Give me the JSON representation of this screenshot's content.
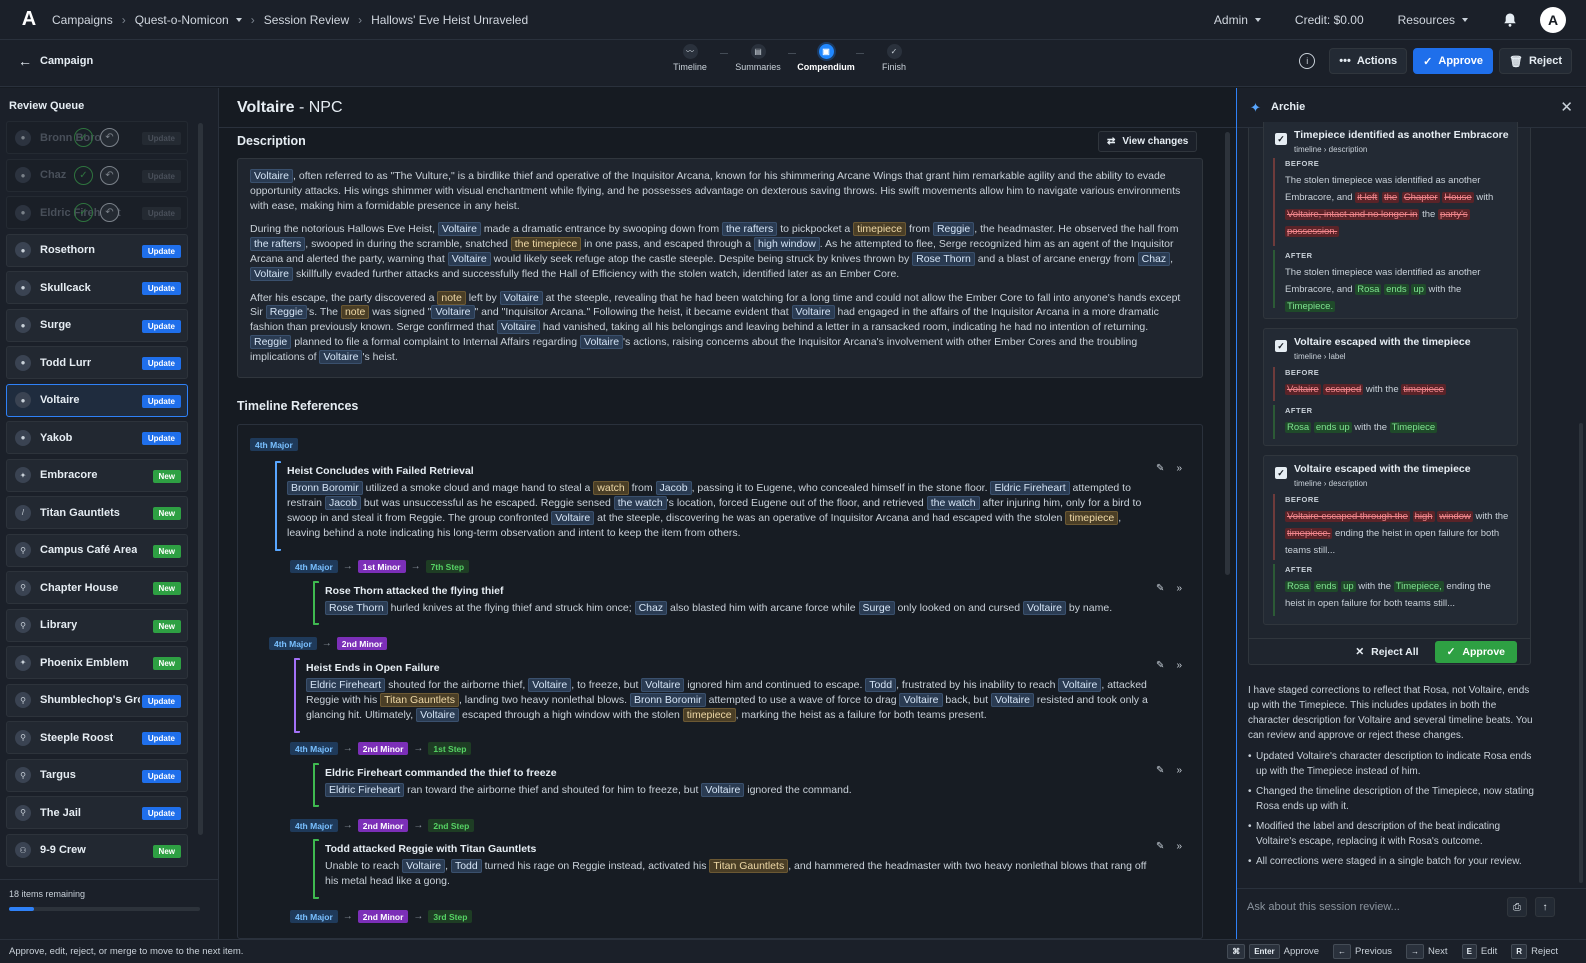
{
  "breadcrumbs": [
    "Campaigns",
    "Quest-o-Nomicon",
    "Session Review",
    "Hallows' Eve Heist Unraveled"
  ],
  "topnav": {
    "admin": "Admin",
    "credit": "Credit: $0.00",
    "resources": "Resources",
    "avatar": "A",
    "logo": "A"
  },
  "back_label": "Campaign",
  "steps": [
    {
      "label": "Timeline"
    },
    {
      "label": "Summaries"
    },
    {
      "label": "Compendium"
    },
    {
      "label": "Finish"
    }
  ],
  "actions": {
    "actions": "Actions",
    "approve": "Approve",
    "reject": "Reject"
  },
  "review_queue": {
    "title": "Review Queue",
    "items": [
      {
        "label": "Bronn Boromir",
        "badge": "Update",
        "state": "done"
      },
      {
        "label": "Chaz",
        "badge": "Update",
        "state": "done"
      },
      {
        "label": "Eldric Fireheart",
        "badge": "Update",
        "state": "done"
      },
      {
        "label": "Rosethorn",
        "badge": "Update"
      },
      {
        "label": "Skullcack",
        "badge": "Update"
      },
      {
        "label": "Surge",
        "badge": "Update"
      },
      {
        "label": "Todd Lurr",
        "badge": "Update"
      },
      {
        "label": "Voltaire",
        "badge": "Update",
        "state": "selected"
      },
      {
        "label": "Yakob",
        "badge": "Update"
      },
      {
        "label": "Embracore",
        "badge": "New"
      },
      {
        "label": "Titan Gauntlets",
        "badge": "New"
      },
      {
        "label": "Campus Café Area",
        "badge": "New"
      },
      {
        "label": "Chapter House",
        "badge": "New"
      },
      {
        "label": "Library",
        "badge": "New"
      },
      {
        "label": "Phoenix Emblem",
        "badge": "New"
      },
      {
        "label": "Shumblechop's Gro...",
        "badge": "Update"
      },
      {
        "label": "Steeple Roost",
        "badge": "Update"
      },
      {
        "label": "Targus",
        "badge": "Update"
      },
      {
        "label": "The Jail",
        "badge": "Update"
      },
      {
        "label": "9-9 Crew",
        "badge": "New"
      }
    ],
    "remaining": "18 items remaining",
    "progress": 0.13
  },
  "entity": {
    "name": "Voltaire",
    "type": " - NPC"
  },
  "description_title": "Description",
  "view_changes": "View changes",
  "description": {
    "p1": [
      {
        "tag": "Voltaire"
      },
      {
        "t": ", often referred to as \"The Vulture,\" is a birdlike thief and operative of the Inquisitor Arcana, known for his shimmering Arcane Wings that grant him remarkable agility and the ability to evade opportunity attacks. His wings shimmer with visual enchantment while flying, and he possesses advantage on dexterous saving throws. His swift movements allow him to navigate various environments with ease, making him a formidable presence in any heist."
      }
    ],
    "p2": [
      {
        "t": "During the notorious Hallows Eve Heist, "
      },
      {
        "tag": "Voltaire"
      },
      {
        "t": " made a dramatic entrance by swooping down from "
      },
      {
        "tag": "the rafters"
      },
      {
        "t": " to pickpocket a "
      },
      {
        "tago": "timepiece"
      },
      {
        "t": " from "
      },
      {
        "tag": "Reggie"
      },
      {
        "t": ", the headmaster. He observed the hall from "
      },
      {
        "tag": "the rafters"
      },
      {
        "t": ", swooped in during the scramble, snatched "
      },
      {
        "tago": "the timepiece"
      },
      {
        "t": " in one pass, and escaped through a "
      },
      {
        "tag": "high window"
      },
      {
        "t": ". As he attempted to flee, Serge recognized him as an agent of the Inquisitor Arcana and alerted the party, warning that "
      },
      {
        "tag": "Voltaire"
      },
      {
        "t": " would likely seek refuge atop the castle steeple. Despite being struck by knives thrown by "
      },
      {
        "tag": "Rose Thorn"
      },
      {
        "t": " and a blast of arcane energy from "
      },
      {
        "tag": "Chaz"
      },
      {
        "t": ", "
      },
      {
        "tag": "Voltaire"
      },
      {
        "t": " skillfully evaded further attacks and successfully fled the Hall of Efficiency with the stolen watch, identified later as an Ember Core."
      }
    ],
    "p3": [
      {
        "t": "After his escape, the party discovered a "
      },
      {
        "tago": "note"
      },
      {
        "t": " left by "
      },
      {
        "tag": "Voltaire"
      },
      {
        "t": " at the steeple, revealing that he had been watching for a long time and could not allow the Ember Core to fall into anyone's hands except Sir "
      },
      {
        "tag": "Reggie"
      },
      {
        "t": "'s. The "
      },
      {
        "tago": "note"
      },
      {
        "t": " was signed \""
      },
      {
        "tag": "Voltaire"
      },
      {
        "t": "\" and \"Inquisitor Arcana.\" Following the heist, it became evident that "
      },
      {
        "tag": "Voltaire"
      },
      {
        "t": " had engaged in the affairs of the Inquisitor Arcana in a more dramatic fashion than previously known. Serge confirmed that "
      },
      {
        "tag": "Voltaire"
      },
      {
        "t": " had vanished, taking all his belongings and leaving behind a letter in a ransacked room, indicating he had no intention of returning. "
      },
      {
        "tag": "Reggie"
      },
      {
        "t": " planned to file a formal complaint to Internal Affairs regarding "
      },
      {
        "tag": "Voltaire"
      },
      {
        "t": "'s actions, raising concerns about the Inquisitor Arcana's involvement with other Ember Cores and the troubling implications of "
      },
      {
        "tag": "Voltaire"
      },
      {
        "t": "'s heist."
      }
    ]
  },
  "timeline_title": "Timeline References",
  "timeline": {
    "chip_top": "4th Major",
    "e1": {
      "title": "Heist Concludes with Failed Retrieval",
      "body": [
        {
          "tag": "Bronn Boromir"
        },
        {
          "t": " utilized a smoke cloud and mage hand to steal a "
        },
        {
          "tago": "watch"
        },
        {
          "t": " from "
        },
        {
          "tag": "Jacob"
        },
        {
          "t": ", passing it to Eugene, who concealed himself in the stone floor. "
        },
        {
          "tag": "Eldric Fireheart"
        },
        {
          "t": " attempted to restrain "
        },
        {
          "tag": "Jacob"
        },
        {
          "t": " but was unsuccessful as he escaped. Reggie sensed "
        },
        {
          "tag": "the watch"
        },
        {
          "t": "'s location, forced Eugene out of the floor, and retrieved "
        },
        {
          "tag": "the watch"
        },
        {
          "t": " after injuring him, only for a bird to swoop in and steal it from Reggie. The group confronted "
        },
        {
          "tag": "Voltaire"
        },
        {
          "t": " at the steeple, discovering he was an operative of Inquisitor Arcana and had escaped with the stolen "
        },
        {
          "tago": "timepiece"
        },
        {
          "t": ", leaving behind a note indicating his long-term observation and intent to keep the item from others."
        }
      ]
    },
    "c1": [
      "4th Major",
      "1st Minor",
      "7th Step"
    ],
    "e2": {
      "title": "Rose Thorn attacked the flying thief",
      "body": [
        {
          "tag": "Rose Thorn"
        },
        {
          "t": " hurled knives at the flying thief and struck him once; "
        },
        {
          "tag": "Chaz"
        },
        {
          "t": " also blasted him with arcane force while "
        },
        {
          "tag": "Surge"
        },
        {
          "t": " only looked on and cursed "
        },
        {
          "tag": "Voltaire"
        },
        {
          "t": " by name."
        }
      ]
    },
    "c2": [
      "4th Major",
      "2nd Minor"
    ],
    "e3": {
      "title": "Heist Ends in Open Failure",
      "body": [
        {
          "tag": "Eldric Fireheart"
        },
        {
          "t": " shouted for the airborne thief, "
        },
        {
          "tag": "Voltaire"
        },
        {
          "t": ", to freeze, but "
        },
        {
          "tag": "Voltaire"
        },
        {
          "t": " ignored him and continued to escape. "
        },
        {
          "tag": "Todd"
        },
        {
          "t": ", frustrated by his inability to reach "
        },
        {
          "tag": "Voltaire"
        },
        {
          "t": ", attacked Reggie with his "
        },
        {
          "tago": "Titan Gauntlets"
        },
        {
          "t": ", landing two heavy nonlethal blows. "
        },
        {
          "tag": "Bronn Boromir"
        },
        {
          "t": " attempted to use a wave of force to drag "
        },
        {
          "tag": "Voltaire"
        },
        {
          "t": " back, but "
        },
        {
          "tag": "Voltaire"
        },
        {
          "t": " resisted and took only a glancing hit. Ultimately, "
        },
        {
          "tag": "Voltaire"
        },
        {
          "t": " escaped through a high window with the stolen "
        },
        {
          "tago": "timepiece"
        },
        {
          "t": ", marking the heist as a failure for both teams present."
        }
      ]
    },
    "c3": [
      "4th Major",
      "2nd Minor",
      "1st Step"
    ],
    "e4": {
      "title": "Eldric Fireheart commanded the thief to freeze",
      "body": [
        {
          "tag": "Eldric Fireheart"
        },
        {
          "t": " ran toward the airborne thief and shouted for him to freeze, but "
        },
        {
          "tag": "Voltaire"
        },
        {
          "t": " ignored the command."
        }
      ]
    },
    "c4": [
      "4th Major",
      "2nd Minor",
      "2nd Step"
    ],
    "e5": {
      "title": "Todd attacked Reggie with Titan Gauntlets",
      "body": [
        {
          "t": "Unable to reach "
        },
        {
          "tag": "Voltaire"
        },
        {
          "t": ", "
        },
        {
          "tag": "Todd"
        },
        {
          "t": " turned his rage on Reggie instead, activated his "
        },
        {
          "tago": "Titan Gauntlets"
        },
        {
          "t": ", and hammered the headmaster with two heavy nonlethal blows that rang off his metal head like a gong."
        }
      ]
    },
    "c5": [
      "4th Major",
      "2nd Minor",
      "3rd Step"
    ]
  },
  "archie": {
    "title": "Archie",
    "card1": {
      "title": "Timepiece identified as another Embracore",
      "path": "timeline › description",
      "before_label": "BEFORE",
      "after_label": "AFTER",
      "before": [
        {
          "t": "The stolen timepiece was identified as another Embracore, and "
        },
        {
          "del": "it left"
        },
        {
          "t": " "
        },
        {
          "del": "the"
        },
        {
          "t": " "
        },
        {
          "del": "Chapter"
        },
        {
          "t": " "
        },
        {
          "del": "House"
        },
        {
          "t": " with "
        },
        {
          "del": "Voltaire, intact and no longer in"
        },
        {
          "t": " the "
        },
        {
          "del": "party's"
        },
        {
          "t": " "
        },
        {
          "del": "possession."
        }
      ],
      "after": [
        {
          "t": "The stolen timepiece was identified as another Embracore, and "
        },
        {
          "ins": "Rosa"
        },
        {
          "t": " "
        },
        {
          "ins": "ends"
        },
        {
          "t": " "
        },
        {
          "ins": "up"
        },
        {
          "t": " with the "
        },
        {
          "ins": "Timepiece."
        }
      ]
    },
    "card2": {
      "title": "Voltaire escaped with the timepiece",
      "path": "timeline › label",
      "before_label": "BEFORE",
      "after_label": "AFTER",
      "before": [
        {
          "del": "Voltaire"
        },
        {
          "t": " "
        },
        {
          "del": "escaped"
        },
        {
          "t": " with the "
        },
        {
          "del": "timepiece"
        }
      ],
      "after": [
        {
          "ins": "Rosa"
        },
        {
          "t": " "
        },
        {
          "ins": "ends up"
        },
        {
          "t": " with the "
        },
        {
          "ins": "Timepiece"
        }
      ]
    },
    "card3": {
      "title": "Voltaire escaped with the timepiece",
      "path": "timeline › description",
      "before_label": "BEFORE",
      "after_label": "AFTER",
      "before": [
        {
          "del": "Voltaire escaped through the"
        },
        {
          "t": " "
        },
        {
          "del": "high"
        },
        {
          "t": " "
        },
        {
          "del": "window"
        },
        {
          "t": " with the "
        },
        {
          "del": "timepiece,"
        },
        {
          "t": " ending the heist in open failure for both teams still..."
        }
      ],
      "after": [
        {
          "ins": "Rosa"
        },
        {
          "t": " "
        },
        {
          "ins": "ends"
        },
        {
          "t": " "
        },
        {
          "ins": "up"
        },
        {
          "t": " with the "
        },
        {
          "ins": "Timepiece,"
        },
        {
          "t": " ending the heist in open failure for both teams still..."
        }
      ]
    },
    "reject_all": "Reject All",
    "approve": "Approve",
    "message": "I have staged corrections to reflect that Rosa, not Voltaire, ends up with the Timepiece. This includes updates in both the character description for Voltaire and several timeline beats. You can review and approve or reject these changes.",
    "bullets": [
      "Updated Voltaire's character description to indicate Rosa ends up with the Timepiece instead of him.",
      "Changed the timeline description of the Timepiece, now stating Rosa ends up with it.",
      "Modified the label and description of the beat indicating Voltaire's escape, replacing it with Rosa's outcome.",
      "All corrections were staged in a single batch for your review."
    ],
    "ask_placeholder": "Ask about this session review..."
  },
  "footer": {
    "hint": "Approve, edit, reject, or merge to move to the next item.",
    "keys": [
      {
        "key": "⌘",
        "key2": "Enter",
        "label": "Approve"
      },
      {
        "key": "←",
        "label": "Previous"
      },
      {
        "key": "→",
        "label": "Next"
      },
      {
        "key": "E",
        "label": "Edit"
      },
      {
        "key": "R",
        "label": "Reject"
      }
    ]
  }
}
